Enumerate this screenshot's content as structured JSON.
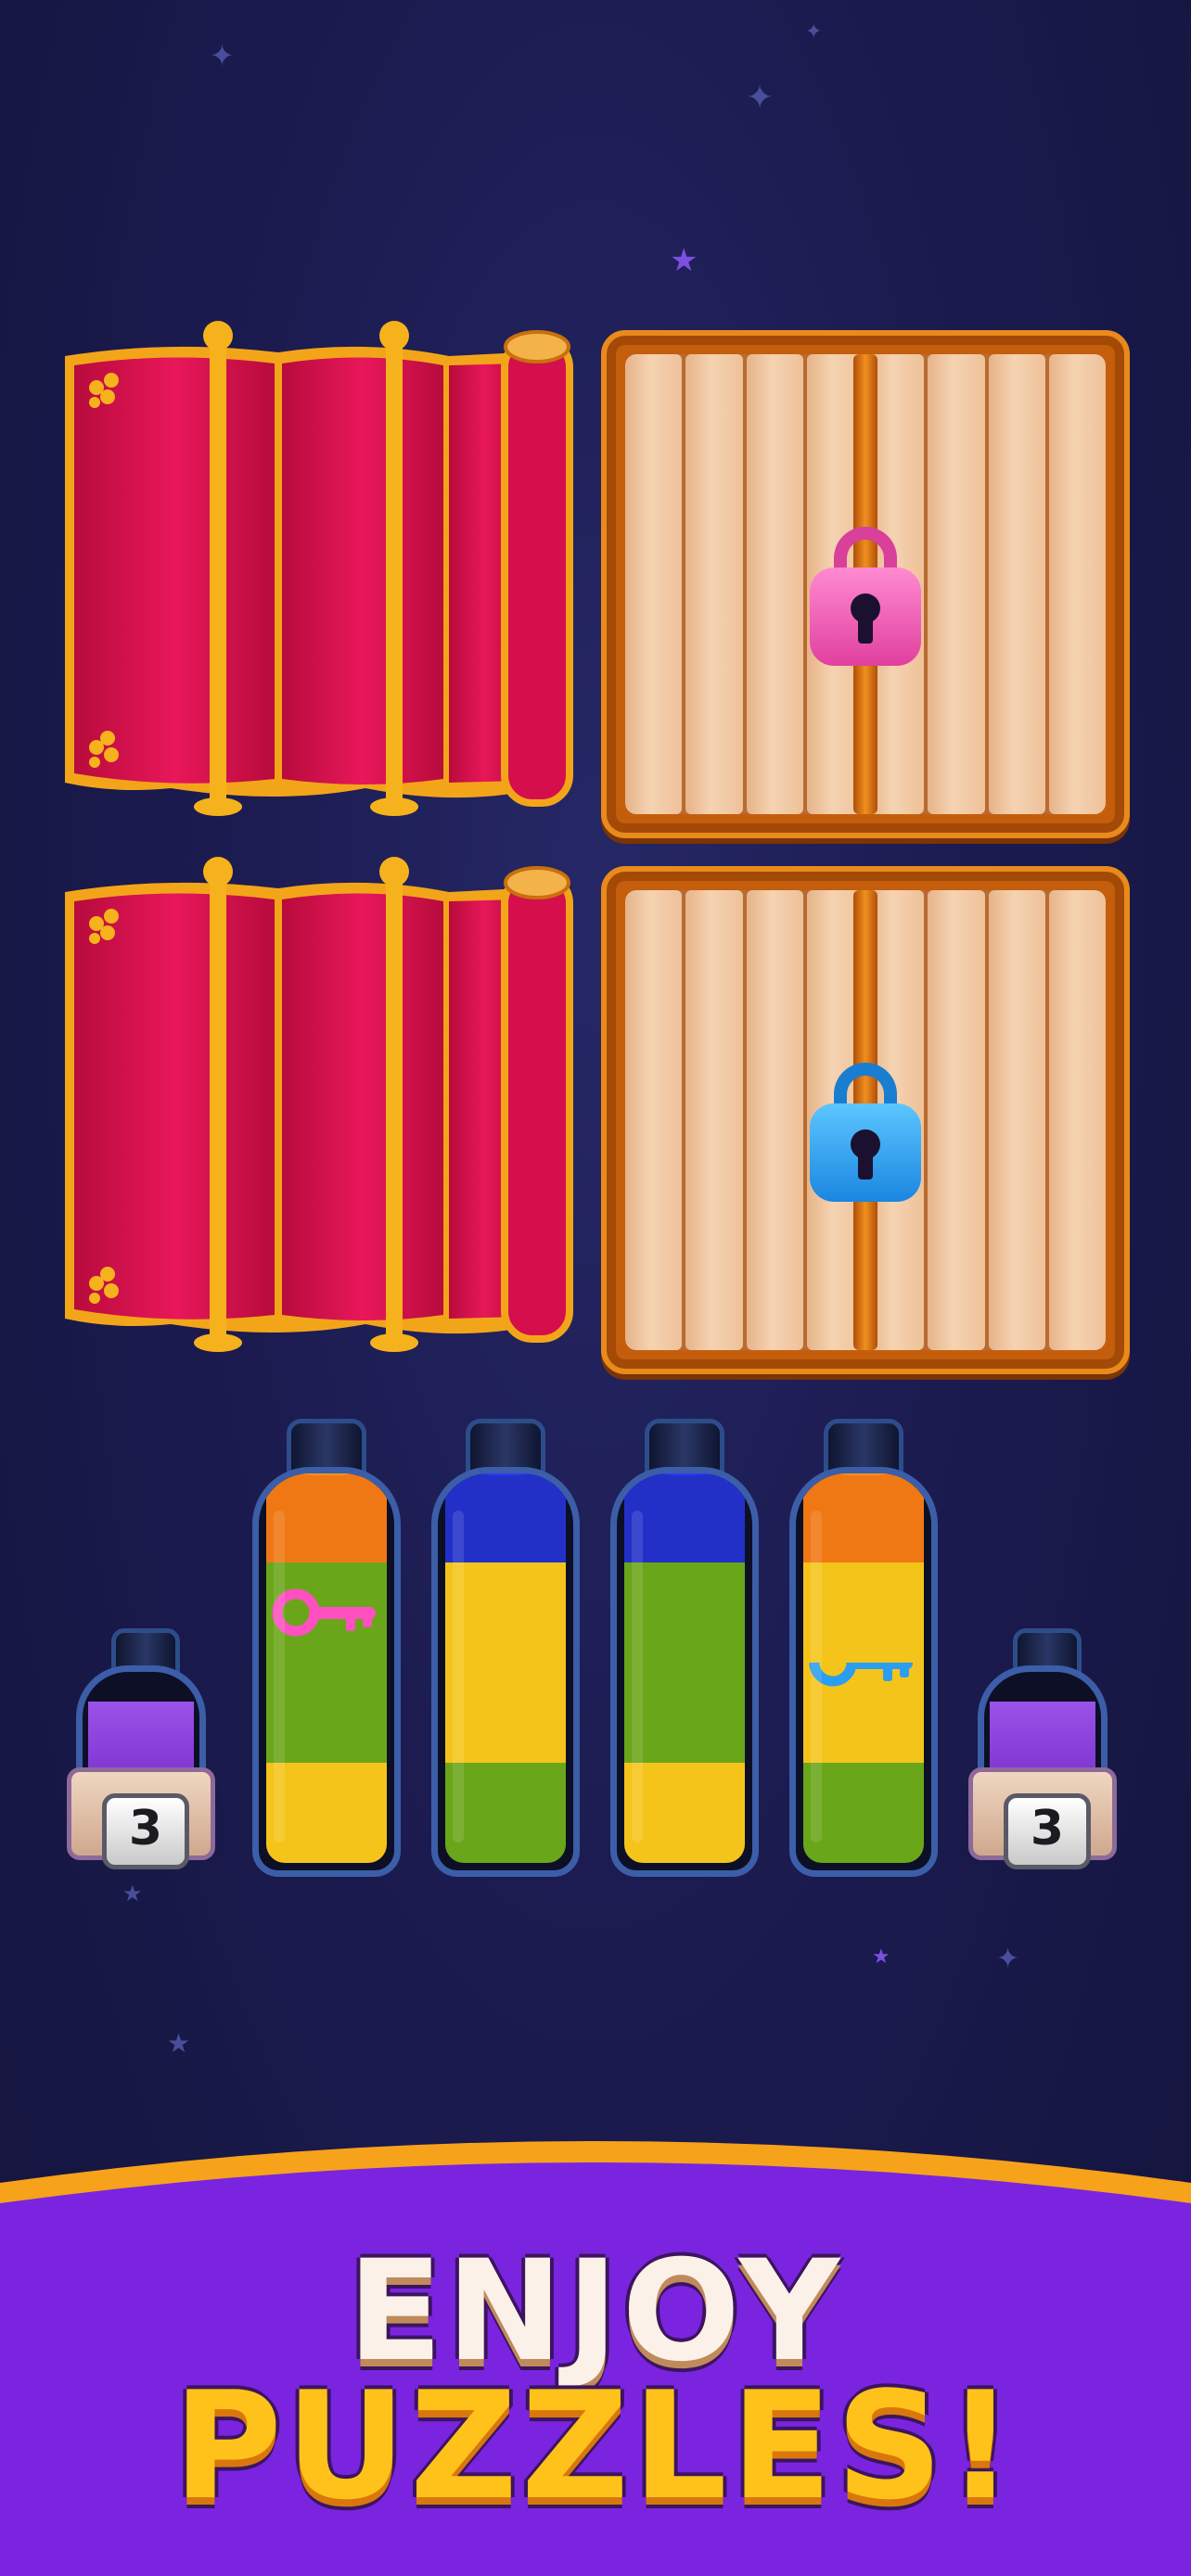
{
  "game": {
    "title_line1": "ENJOY",
    "title_line2": "PUZZLES!",
    "colors": {
      "background": "#1b1b50",
      "curtain_red": "#d8104a",
      "curtain_gold": "#f3a51a",
      "wood": "#f2cba6",
      "frame_orange": "#e07a10",
      "orange": "#f07814",
      "blue": "#2230c8",
      "yellow": "#f5c41a",
      "green": "#6aa61a",
      "purple": "#8a40dc",
      "pink_lock": "#ef57b8",
      "blue_lock": "#28a0f0",
      "banner_purple": "#7a24e0",
      "banner_border": "#f6a21a"
    }
  },
  "board": {
    "tiles": [
      {
        "type": "curtain",
        "state": "closed"
      },
      {
        "type": "locked-panel",
        "lock_color": "pink",
        "icon": "pink-padlock-icon"
      },
      {
        "type": "curtain",
        "state": "closed"
      },
      {
        "type": "locked-panel",
        "lock_color": "blue",
        "icon": "blue-padlock-icon"
      }
    ]
  },
  "bottles": {
    "small_left": {
      "count": "3",
      "liquid": "purple"
    },
    "small_right": {
      "count": "3",
      "liquid": "purple"
    },
    "tubes": [
      {
        "layers_bottom_to_top": [
          "yellow",
          "green",
          "green",
          "orange"
        ],
        "key": "pink-key-icon"
      },
      {
        "layers_bottom_to_top": [
          "green",
          "yellow",
          "yellow",
          "blue"
        ]
      },
      {
        "layers_bottom_to_top": [
          "yellow",
          "green",
          "green",
          "blue"
        ]
      },
      {
        "layers_bottom_to_top": [
          "green",
          "yellow",
          "yellow",
          "orange"
        ],
        "key": "blue-key-icon"
      }
    ]
  }
}
